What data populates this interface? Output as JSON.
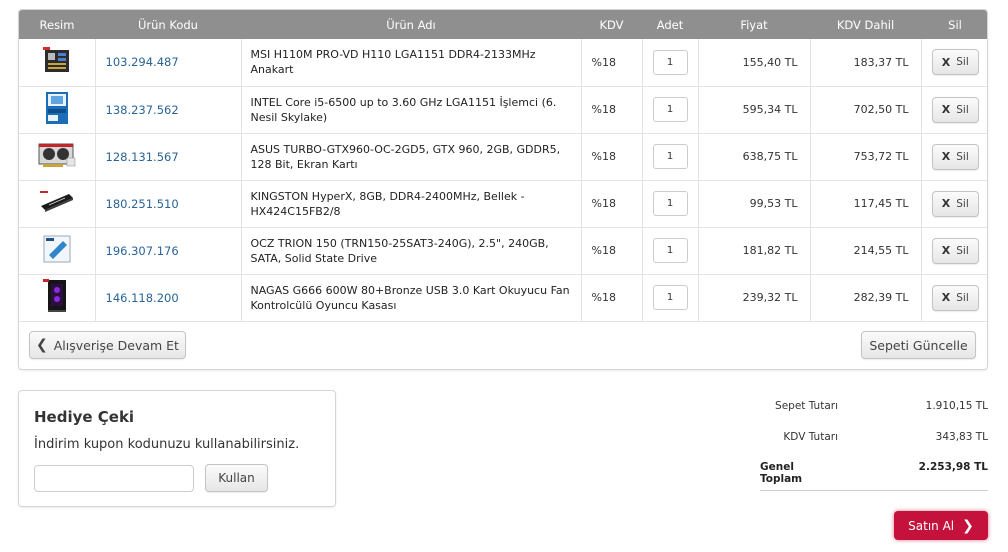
{
  "table": {
    "headers": [
      "Resim",
      "Ürün Kodu",
      "Ürün Adı",
      "KDV",
      "Adet",
      "Fiyat",
      "KDV Dahil",
      "Sil"
    ],
    "rows": [
      {
        "code": "103.294.487",
        "name": "MSI H110M PRO-VD H110 LGA1151 DDR4-2133MHz Anakart",
        "kdv": "%18",
        "qty": "1",
        "price": "155,40 TL",
        "price_vat": "183,37 TL",
        "icon": "motherboard-icon"
      },
      {
        "code": "138.237.562",
        "name": "INTEL Core i5-6500 up to 3.60 GHz LGA1151 İşlemci (6. Nesil Skylake)",
        "kdv": "%18",
        "qty": "1",
        "price": "595,34 TL",
        "price_vat": "702,50 TL",
        "icon": "cpu-box-icon"
      },
      {
        "code": "128.131.567",
        "name": "ASUS TURBO-GTX960-OC-2GD5, GTX 960, 2GB, GDDR5, 128 Bit, Ekran Kartı",
        "kdv": "%18",
        "qty": "1",
        "price": "638,75 TL",
        "price_vat": "753,72 TL",
        "icon": "graphics-card-icon"
      },
      {
        "code": "180.251.510",
        "name": "KINGSTON HyperX, 8GB, DDR4-2400MHz, Bellek - HX424C15FB2/8",
        "kdv": "%18",
        "qty": "1",
        "price": "99,53 TL",
        "price_vat": "117,45 TL",
        "icon": "ram-icon"
      },
      {
        "code": "196.307.176",
        "name": "OCZ TRION 150 (TRN150-25SAT3-240G), 2.5\", 240GB, SATA, Solid State Drive",
        "kdv": "%18",
        "qty": "1",
        "price": "181,82 TL",
        "price_vat": "214,55 TL",
        "icon": "ssd-box-icon"
      },
      {
        "code": "146.118.200",
        "name": "NAGAS G666 600W 80+Bronze USB 3.0 Kart Okuyucu Fan Kontrolcülü Oyuncu Kasası",
        "kdv": "%18",
        "qty": "1",
        "price": "239,32 TL",
        "price_vat": "282,39 TL",
        "icon": "pc-case-icon"
      }
    ],
    "delete_label": "Sil",
    "delete_mark": "X"
  },
  "actions": {
    "continue_label": "Alışverişe Devam Et",
    "update_label": "Sepeti Güncelle"
  },
  "gift": {
    "title": "Hediye Çeki",
    "description": "İndirim kupon kodunuzu kullanabilirsiniz.",
    "input_value": "",
    "button_label": "Kullan"
  },
  "totals": {
    "subtotal_label": "Sepet Tutarı",
    "subtotal_value": "1.910,15 TL",
    "vat_label": "KDV Tutarı",
    "vat_value": "343,83 TL",
    "grand_label": "Genel Toplam",
    "grand_value": "2.253,98 TL"
  },
  "checkout": {
    "label": "Satın Al"
  },
  "colors": {
    "header_bg": "#8f8f8f",
    "code_link": "#2a6496",
    "checkout_bg": "#c4123c"
  }
}
